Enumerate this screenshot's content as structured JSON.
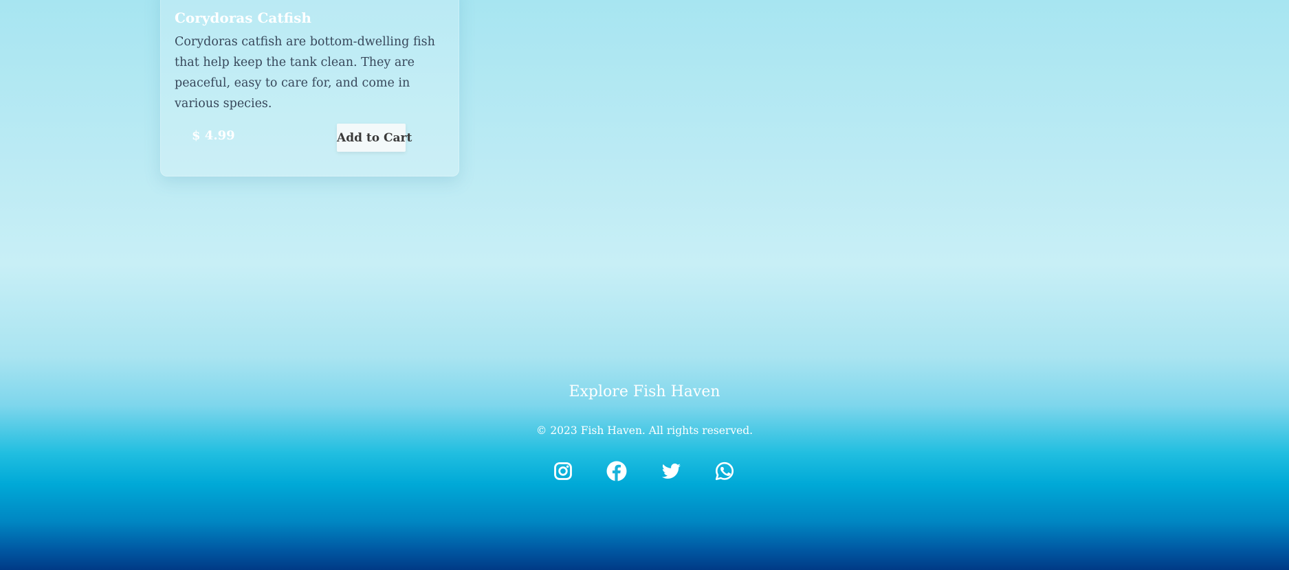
{
  "product": {
    "name": "Corydoras Catfish",
    "description": "Corydoras catfish are bottom-dwelling fish that help keep the tank clean. They are peaceful, easy to care for, and come in various species.",
    "price": "$ 4.99",
    "cart_label": "Add to Cart"
  },
  "footer": {
    "title": "Explore Fish Haven",
    "copyright": "© 2023 Fish Haven. All rights reserved.",
    "social": [
      {
        "icon": "instagram-icon"
      },
      {
        "icon": "facebook-icon"
      },
      {
        "icon": "twitter-icon"
      },
      {
        "icon": "whatsapp-icon"
      }
    ]
  },
  "colors": {
    "text_light": "#ffffff",
    "text_dark": "#37475a",
    "ocean_deep": "#003a86",
    "ocean_mid": "#00a9d7",
    "sky_light": "#c8eff6"
  }
}
